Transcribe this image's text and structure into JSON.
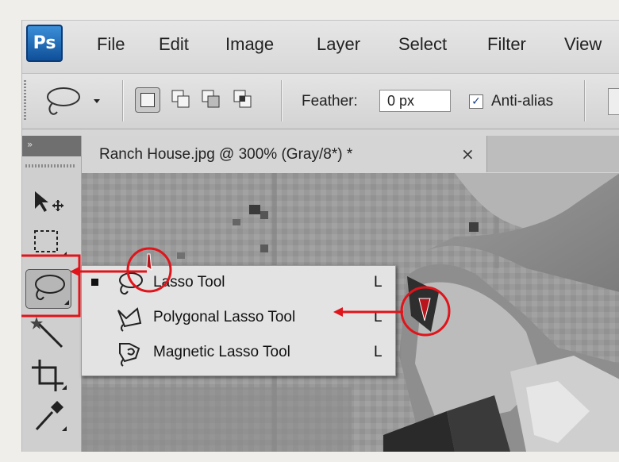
{
  "app": {
    "logo": "Ps"
  },
  "menu": [
    "File",
    "Edit",
    "Image",
    "Layer",
    "Select",
    "Filter",
    "View"
  ],
  "options": {
    "tool_icon": "lasso-icon",
    "feather_label": "Feather:",
    "feather_value": "0 px",
    "antialias_label": "Anti-alias",
    "antialias_checked": true
  },
  "toolbox": {
    "tools": [
      "move-tool-icon",
      "marquee-tool-icon",
      "lasso-tool-icon",
      "magic-wand-tool-icon",
      "crop-tool-icon",
      "eyedropper-tool-icon"
    ]
  },
  "document": {
    "tab_title": "Ranch House.jpg @ 300% (Gray/8*) *",
    "close_glyph": "×"
  },
  "flyout": {
    "items": [
      {
        "label": "Lasso Tool",
        "key": "L",
        "icon": "lasso-icon",
        "selected": true
      },
      {
        "label": "Polygonal Lasso Tool",
        "key": "L",
        "icon": "polygonal-lasso-icon",
        "selected": false
      },
      {
        "label": "Magnetic Lasso Tool",
        "key": "L",
        "icon": "magnetic-lasso-icon",
        "selected": false
      }
    ]
  },
  "colors": {
    "annotation": "#e0141b",
    "ps_blue": "#1b63b4"
  }
}
